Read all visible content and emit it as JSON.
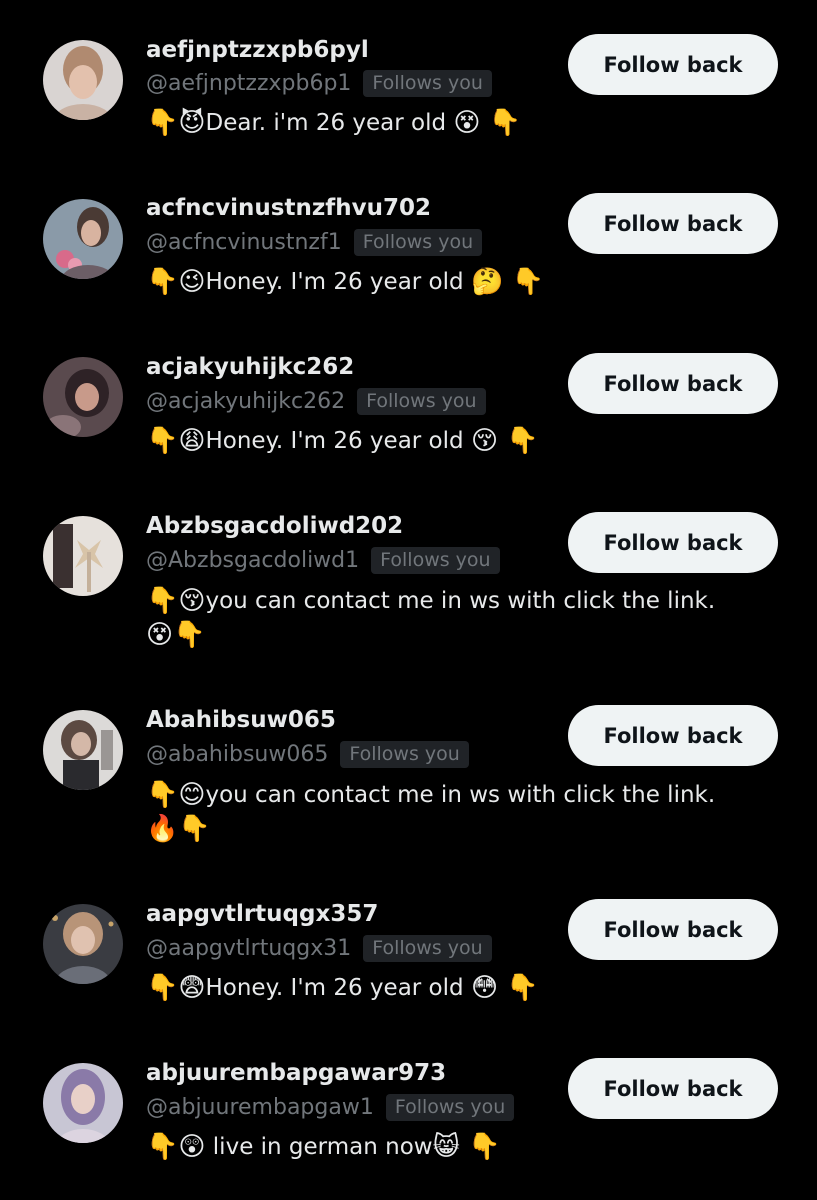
{
  "follow_button_label": "Follow back",
  "follows_you_label": "Follows you",
  "accounts": [
    {
      "display_name": "aefjnptzzxpb6pyl",
      "handle": "@aefjnptzzxpb6p1",
      "bio_text": "Dear. i'm 26 year old",
      "bio_lead": "👇😈",
      "bio_trail": "😵 👇",
      "bio_wrap": ""
    },
    {
      "display_name": "acfncvinustnzfhvu702",
      "handle": "@acfncvinustnzf1",
      "bio_text": "Honey. I'm 26 year old",
      "bio_lead": "👇😉",
      "bio_trail": "🤔 👇",
      "bio_wrap": ""
    },
    {
      "display_name": "acjakyuhijkc262",
      "handle": "@acjakyuhijkc262",
      "bio_text": "Honey. I'm 26 year old",
      "bio_lead": "👇😩",
      "bio_trail": "😚 👇",
      "bio_wrap": ""
    },
    {
      "display_name": "Abzbsgacdoliwd202",
      "handle": "@Abzbsgacdoliwd1",
      "bio_text": "you can contact me in ws with click the link.",
      "bio_lead": "👇😚",
      "bio_trail": "",
      "bio_wrap": "😵👇"
    },
    {
      "display_name": "Abahibsuw065",
      "handle": "@abahibsuw065",
      "bio_text": "you can contact me in ws with click the link.",
      "bio_lead": "👇😊",
      "bio_trail": "",
      "bio_wrap": "🔥👇"
    },
    {
      "display_name": "aapgvtlrtuqgx357",
      "handle": "@aapgvtlrtuqgx31",
      "bio_text": "Honey. I'm 26 year old",
      "bio_lead": "👇😨",
      "bio_trail": "😳 👇",
      "bio_wrap": ""
    },
    {
      "display_name": "abjuurembapgawar973",
      "handle": "@abjuurembapgaw1",
      "bio_text": "live in german now",
      "bio_lead": "👇😲",
      "bio_trail": "😸 👇",
      "bio_wrap": ""
    }
  ],
  "colors": {
    "background": "#000000",
    "primary_text": "#e7e9ea",
    "secondary_text": "#71767b",
    "badge_bg": "#202327",
    "button_bg": "#eff3f4",
    "button_text": "#0f1419"
  }
}
